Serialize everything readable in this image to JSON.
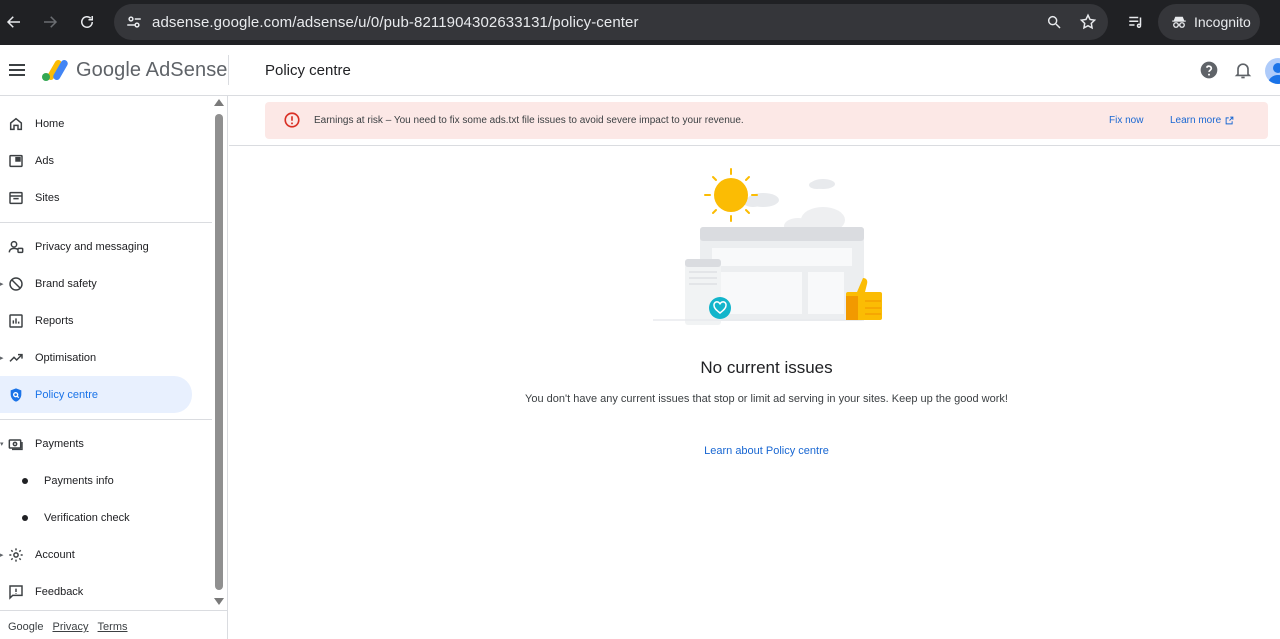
{
  "browser": {
    "url": "adsense.google.com/adsense/u/0/pub-8211904302633131/policy-center",
    "incognito_label": "Incognito"
  },
  "header": {
    "logo_text": "Google AdSense",
    "page_title": "Policy centre"
  },
  "sidebar": {
    "items": [
      {
        "label": "Home",
        "icon": "home-icon"
      },
      {
        "label": "Ads",
        "icon": "ads-icon"
      },
      {
        "label": "Sites",
        "icon": "sites-icon"
      },
      {
        "label": "Privacy and messaging",
        "icon": "privacy-icon"
      },
      {
        "label": "Brand safety",
        "icon": "block-icon"
      },
      {
        "label": "Reports",
        "icon": "reports-icon"
      },
      {
        "label": "Optimisation",
        "icon": "trending-icon"
      },
      {
        "label": "Policy centre",
        "icon": "shield-icon",
        "active": true
      },
      {
        "label": "Payments",
        "icon": "payments-icon"
      },
      {
        "label": "Payments info",
        "sub": true
      },
      {
        "label": "Verification check",
        "sub": true
      },
      {
        "label": "Account",
        "icon": "gear-icon"
      },
      {
        "label": "Feedback",
        "icon": "feedback-icon"
      }
    ],
    "footer": {
      "google": "Google",
      "privacy": "Privacy",
      "terms": "Terms"
    }
  },
  "alert": {
    "message": "Earnings at risk – You need to fix some ads.txt file issues to avoid severe impact to your revenue.",
    "fix_now": "Fix now",
    "learn_more": "Learn more"
  },
  "empty_state": {
    "title": "No current issues",
    "description": "You don't have any current issues that stop or limit ad serving in your sites. Keep up the good work!",
    "link": "Learn about Policy centre"
  },
  "colors": {
    "accent": "#1a73e8",
    "alert_bg": "#fce8e6",
    "error_red": "#d93025",
    "active_bg": "#e8f0fe"
  }
}
